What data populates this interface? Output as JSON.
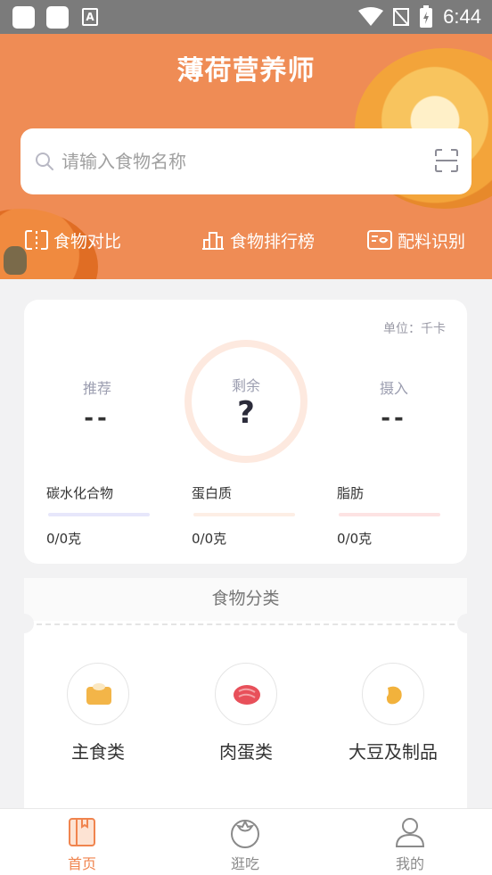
{
  "status_bar": {
    "time": "6:44"
  },
  "header": {
    "title": "薄荷营养师",
    "search": {
      "placeholder": "请输入食物名称"
    },
    "quick_actions": [
      {
        "label": "食物对比",
        "icon": "compare-icon"
      },
      {
        "label": "食物排行榜",
        "icon": "ranking-icon"
      },
      {
        "label": "配料识别",
        "icon": "ingredient-scan-icon"
      }
    ]
  },
  "summary": {
    "unit": "单位：千卡",
    "recommended": {
      "label": "推荐",
      "value": "--"
    },
    "remaining": {
      "label": "剩余",
      "value": "?"
    },
    "intake": {
      "label": "摄入",
      "value": "--"
    },
    "nutrients": [
      {
        "label": "碳水化合物",
        "value": "0/0克",
        "color": "#e7e7fb"
      },
      {
        "label": "蛋白质",
        "value": "0/0克",
        "color": "#fdeee5"
      },
      {
        "label": "脂肪",
        "value": "0/0克",
        "color": "#fde3e3"
      }
    ]
  },
  "categories": {
    "title": "食物分类",
    "items": [
      {
        "label": "主食类",
        "icon": "staple-food-icon"
      },
      {
        "label": "肉蛋类",
        "icon": "meat-egg-icon"
      },
      {
        "label": "大豆及制品",
        "icon": "soybean-icon"
      }
    ]
  },
  "bottom_nav": {
    "items": [
      {
        "label": "首页",
        "active": true
      },
      {
        "label": "逛吃",
        "active": false
      },
      {
        "label": "我的",
        "active": false
      }
    ],
    "active_color": "#f0844e",
    "inactive_color": "#8a8a8a"
  },
  "colors": {
    "accent": "#ef8c55"
  }
}
